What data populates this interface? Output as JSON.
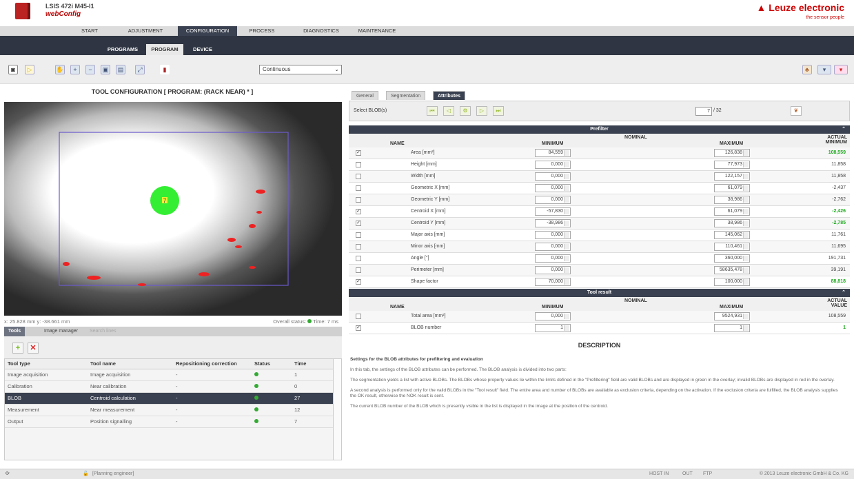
{
  "app": {
    "product": "LSIS 472i M45-I1",
    "subtitle": "webConfig",
    "brand": "Leuze electronic",
    "tagline": "the sensor people"
  },
  "nav1": [
    "START",
    "ADJUSTMENT",
    "CONFIGURATION",
    "PROCESS",
    "DIAGNOSTICS",
    "MAINTENANCE"
  ],
  "nav2": [
    "PROGRAMS",
    "PROGRAM",
    "DEVICE"
  ],
  "toolbar": {
    "mode": "Continuous"
  },
  "left": {
    "title": "TOOL CONFIGURATION   [ PROGRAM: (RACK NEAR) * ]",
    "coords": "x: 25.828 mm y: -38.661 mm",
    "overall": "Overall status:",
    "time": "Time: 7 ms",
    "tabs": [
      "Tools",
      "Image manager",
      "Search lines"
    ],
    "overlay_marker": "7"
  },
  "tools": {
    "headers": [
      "Tool type",
      "Tool name",
      "Repositioning correction",
      "Status",
      "Time"
    ],
    "rows": [
      {
        "type": "Image acquisition",
        "name": "Image acquisition",
        "rep": "-",
        "time": "1"
      },
      {
        "type": "Calibration",
        "name": "Near calibration",
        "rep": "-",
        "time": "0"
      },
      {
        "type": "BLOB",
        "name": "Centroid calculation",
        "rep": "-",
        "time": "27"
      },
      {
        "type": "Measurement",
        "name": "Near measurement",
        "rep": "-",
        "time": "12"
      },
      {
        "type": "Output",
        "name": "Position signalling",
        "rep": "-",
        "time": "7"
      }
    ]
  },
  "right": {
    "tabs": [
      "General",
      "Segmentation",
      "Attributes"
    ],
    "select_label": "Select BLOB(s)",
    "blob_index": "7",
    "blob_total": "/ 32",
    "prefilter": "Prefilter",
    "toolresult": "Tool result",
    "cols": {
      "name": "NAME",
      "min": "MINIMUM",
      "nom": "NOMINAL",
      "max": "MAXIMUM",
      "actmin": "ACTUAL MINIMUM",
      "actval": "ACTUAL VALUE"
    },
    "attrs": [
      {
        "checked": true,
        "name": "Area [mm²]",
        "min": "84,559",
        "max": "126,838",
        "act": "108,559",
        "ok": true
      },
      {
        "checked": false,
        "name": "Height [mm]",
        "min": "0,000",
        "max": "77,973",
        "act": "11,858",
        "ok": false
      },
      {
        "checked": false,
        "name": "Width [mm]",
        "min": "0,000",
        "max": "122,157",
        "act": "11,858",
        "ok": false
      },
      {
        "checked": false,
        "name": "Geometric X [mm]",
        "min": "0,000",
        "max": "61,079",
        "act": "-2,437",
        "ok": false
      },
      {
        "checked": false,
        "name": "Geometric Y [mm]",
        "min": "0,000",
        "max": "38,986",
        "act": "-2,762",
        "ok": false
      },
      {
        "checked": true,
        "name": "Centroid X [mm]",
        "min": "-57,830",
        "max": "61,079",
        "act": "-2,426",
        "ok": true
      },
      {
        "checked": true,
        "name": "Centroid Y [mm]",
        "min": "-38,986",
        "max": "38,986",
        "act": "-2,785",
        "ok": true
      },
      {
        "checked": false,
        "name": "Major axis [mm]",
        "min": "0,000",
        "max": "145,062",
        "act": "11,761",
        "ok": false
      },
      {
        "checked": false,
        "name": "Minor axis [mm]",
        "min": "0,000",
        "max": "110,461",
        "act": "11,695",
        "ok": false
      },
      {
        "checked": false,
        "name": "Angle [°]",
        "min": "0,000",
        "max": "360,000",
        "act": "191,731",
        "ok": false
      },
      {
        "checked": false,
        "name": "Perimeter [mm]",
        "min": "0,000",
        "max": "58635,478",
        "act": "39,191",
        "ok": false
      },
      {
        "checked": true,
        "name": "Shape factor",
        "min": "70,000",
        "max": "100,000",
        "act": "88,818",
        "ok": true
      }
    ],
    "results": [
      {
        "checked": false,
        "name": "Total area [mm²]",
        "min": "0,000",
        "max": "9524,931",
        "act": "108,559",
        "ok": false
      },
      {
        "checked": true,
        "name": "BLOB number",
        "min": "1",
        "max": "1",
        "act": "1",
        "ok": true
      }
    ]
  },
  "desc": {
    "title": "DESCRIPTION",
    "heading": "Settings for the BLOB attributes for prefiltering and evaluation",
    "p1": "In this tab, the settings of the BLOB attributes can be performed. The BLOB analysis is divided into two parts:",
    "p2": "The segmentation yields a list with active BLOBs. The BLOBs whose property values lie within the limits defined in the \"Prefiltering\" field are valid BLOBs and are displayed in green in the overlay; invalid BLOBs are displayed in red in the overlay.",
    "p3": "A second analysis is performed only for the valid BLOBs in the \"Tool result\" field. The entire area and number of BLOBs are available as exclusion criteria, depending on the activation. If the exclusion criteria are fulfilled, the BLOB analysis supplies the OK result, otherwise the NOK result is sent.",
    "p4": "The current BLOB number of the BLOB which is presently visible in the list is displayed in the image at the position of the centroid."
  },
  "status": {
    "user": "[Planning engineer]",
    "host": "HOST IN",
    "out": "OUT",
    "ftp": "FTP",
    "copyright": "© 2013 Leuze electronic GmbH & Co. KG"
  }
}
